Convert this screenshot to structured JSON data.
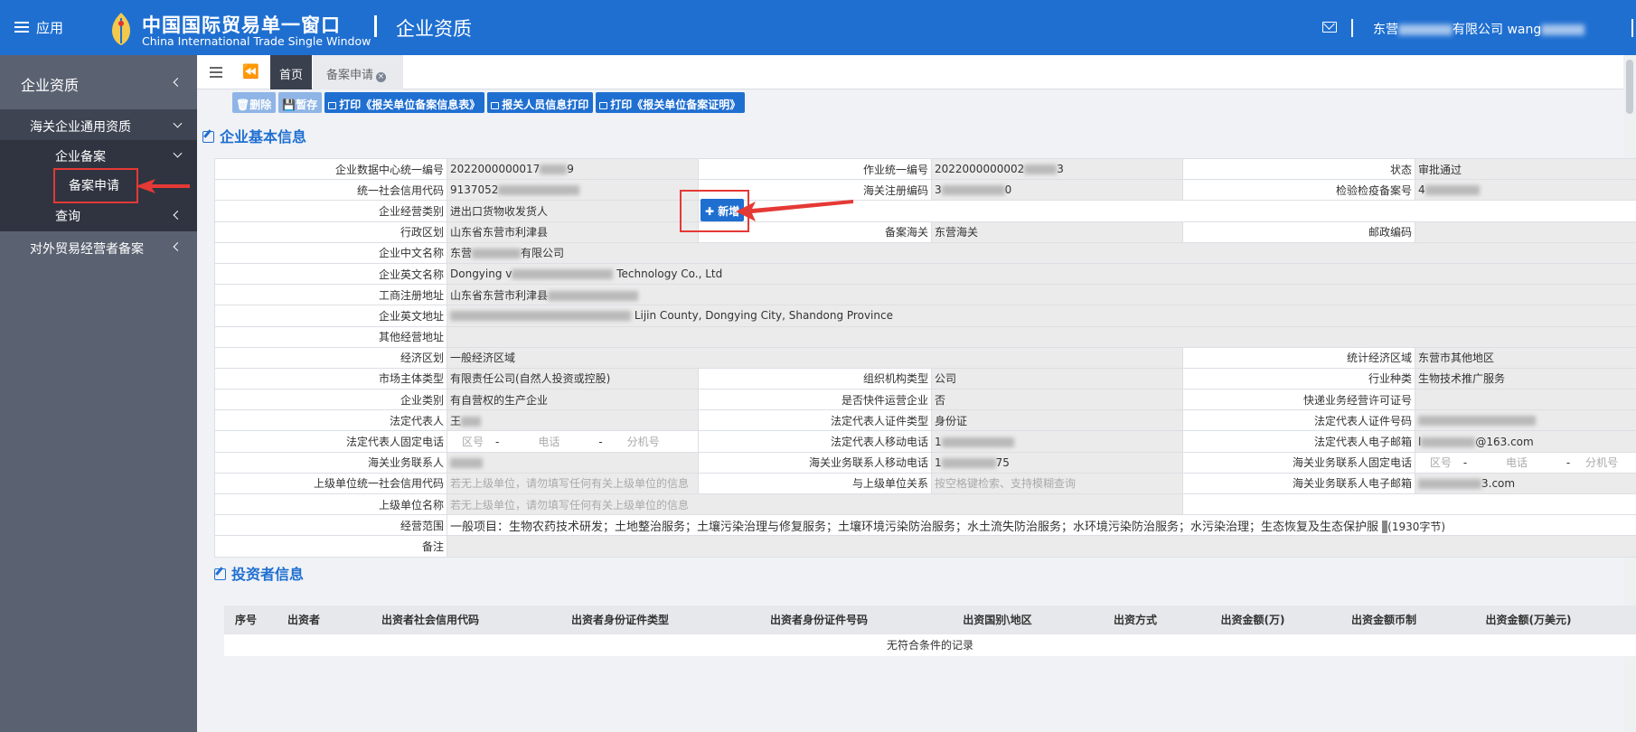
{
  "header": {
    "menu_label": "应用",
    "brand_cn": "中国国际贸易单一窗口",
    "brand_en": "China International Trade Single Window",
    "page_title": "企业资质",
    "user_prefix": "东营",
    "user_company_suffix": "有限公司",
    "user_name": "wang"
  },
  "sidebar": {
    "title": "企业资质",
    "haiguan": "海关企业通用资质",
    "qiye_beian": "企业备案",
    "beian_apply": "备案申请",
    "query": "查询",
    "duiwai": "对外贸易经营者备案"
  },
  "tabs": {
    "home": "首页",
    "beian": "备案申请",
    "close": "×"
  },
  "toolbar": {
    "delete": "删除",
    "save": "暂存",
    "print_info": "打印《报关单位备案信息表》",
    "print_staff": "报关人员信息打印",
    "print_cert": "打印《报关单位备案证明》"
  },
  "section_basic": "企业基本信息",
  "section_investor": "投资者信息",
  "add_button": "新增",
  "form": {
    "l_data_center_no": "企业数据中心统一编号",
    "v_data_center_no": "2022000000017",
    "v_data_center_no_end": "9",
    "l_job_no": "作业统一编号",
    "v_job_no": "2022000000002",
    "v_job_no_end": "3",
    "l_status": "状态",
    "v_status": "审批通过",
    "l_credit_code": "统一社会信用代码",
    "v_credit_code": "9137052",
    "l_customs_reg": "海关注册编码",
    "v_customs_reg": "3",
    "v_customs_reg_end": "0",
    "l_inspection_no": "检验检疫备案号",
    "v_inspection_no": "4",
    "l_biz_type": "企业经营类别",
    "v_biz_type": "进出口货物收发货人",
    "l_district": "行政区划",
    "v_district": "山东省东营市利津县",
    "l_record_customs": "备案海关",
    "v_record_customs": "东营海关",
    "l_postcode": "邮政编码",
    "l_cn_name": "企业中文名称",
    "v_cn_name_a": "东营",
    "v_cn_name_b": "有限公司",
    "l_en_name": "企业英文名称",
    "v_en_name_a": "Dongying v",
    "v_en_name_b": "Technology Co., Ltd",
    "l_reg_addr": "工商注册地址",
    "v_reg_addr": "山东省东营市利津县",
    "l_en_addr": "企业英文地址",
    "v_en_addr": "Lijin County, Dongying City, Shandong Province",
    "l_other_addr": "其他经营地址",
    "l_econ_zone": "经济区划",
    "v_econ_zone": "一般经济区域",
    "l_stat_zone": "统计经济区域",
    "v_stat_zone": "东营市其他地区",
    "l_market_type": "市场主体类型",
    "v_market_type": "有限责任公司(自然人投资或控股)",
    "l_org_type": "组织机构类型",
    "v_org_type": "公司",
    "l_industry": "行业种类",
    "v_industry": "生物技术推广服务",
    "l_ent_category": "企业类别",
    "v_ent_category": "有自营权的生产企业",
    "l_express": "是否快件运营企业",
    "v_express": "否",
    "l_express_license": "快递业务经营许可证号",
    "l_legal_rep": "法定代表人",
    "v_legal_rep": "王",
    "l_legal_id_type": "法定代表人证件类型",
    "v_legal_id_type": "身份证",
    "l_legal_id_no": "法定代表人证件号码",
    "l_legal_phone": "法定代表人固定电话",
    "l_legal_mobile": "法定代表人移动电话",
    "v_legal_mobile": "1",
    "l_legal_email": "法定代表人电子邮箱",
    "v_legal_email_a": "l",
    "v_legal_email_b": "@163.com",
    "l_contact": "海关业务联系人",
    "l_contact_mobile": "海关业务联系人移动电话",
    "v_contact_mobile_a": "1",
    "v_contact_mobile_b": "75",
    "l_contact_phone": "海关业务联系人固定电话",
    "l_parent_credit": "上级单位统一社会信用代码",
    "v_parent_credit": "若无上级单位，请勿填写任何有关上级单位的信息",
    "l_parent_rel": "与上级单位关系",
    "v_parent_rel": "按空格键检索、支持模糊查询",
    "l_contact_email": "海关业务联系人电子邮箱",
    "v_contact_email": "3.com",
    "l_parent_name": "上级单位名称",
    "v_parent_name": "若无上级单位，请勿填写任何有关上级单位的信息",
    "l_scope": "经营范围",
    "v_scope": "一般项目：生物农药技术研发；土地整治服务；土壤污染治理与修复服务；土壤环境污染防治服务；水土流失防治服务；水环境污染防治服务；水污染治理；生态恢复及生态保护服",
    "v_scope_count": "(1930字节)",
    "l_remark": "备注",
    "ph_area": "区号",
    "ph_phone": "电话",
    "ph_ext": "分机号",
    "dash": "-"
  },
  "investor": {
    "columns": [
      "序号",
      "出资者",
      "出资者社会信用代码",
      "出资者身份证件类型",
      "出资者身份证件号码",
      "出资国别\\地区",
      "出资方式",
      "出资金额(万)",
      "出资金额币制",
      "出资金额(万美元)"
    ],
    "empty": "无符合条件的记录"
  },
  "colors": {
    "primary": "#1f6fd1",
    "sidebar": "#5a6170",
    "sidebar_dark": "#2f3440",
    "highlight": "#e53935"
  }
}
